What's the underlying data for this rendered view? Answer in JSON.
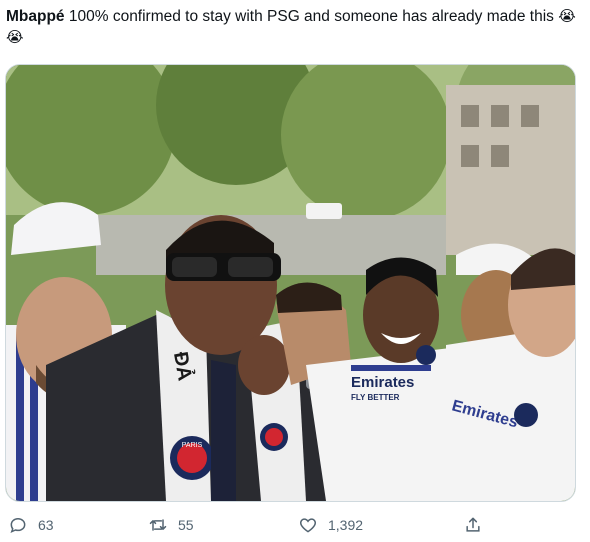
{
  "tweet": {
    "author_bold": "Mbappé",
    "text": " 100% confirmed to stay with PSG and someone has already made this ",
    "emoji": "😭😭"
  },
  "image_text": {
    "scarf_text": "ĐẢ",
    "shirt_sponsor": "Emirates",
    "shirt_sub": "FLY BETTER",
    "crest_label": "PARIS"
  },
  "actions": {
    "reply_count": "63",
    "retweet_count": "55",
    "like_count": "1,392"
  },
  "icons": {
    "reply": "reply-icon",
    "retweet": "retweet-icon",
    "like": "heart-icon",
    "share": "share-icon"
  },
  "colors": {
    "muted": "#536471",
    "text": "#0f1419",
    "psg_navy": "#1b2a5c",
    "psg_red": "#d22630"
  }
}
